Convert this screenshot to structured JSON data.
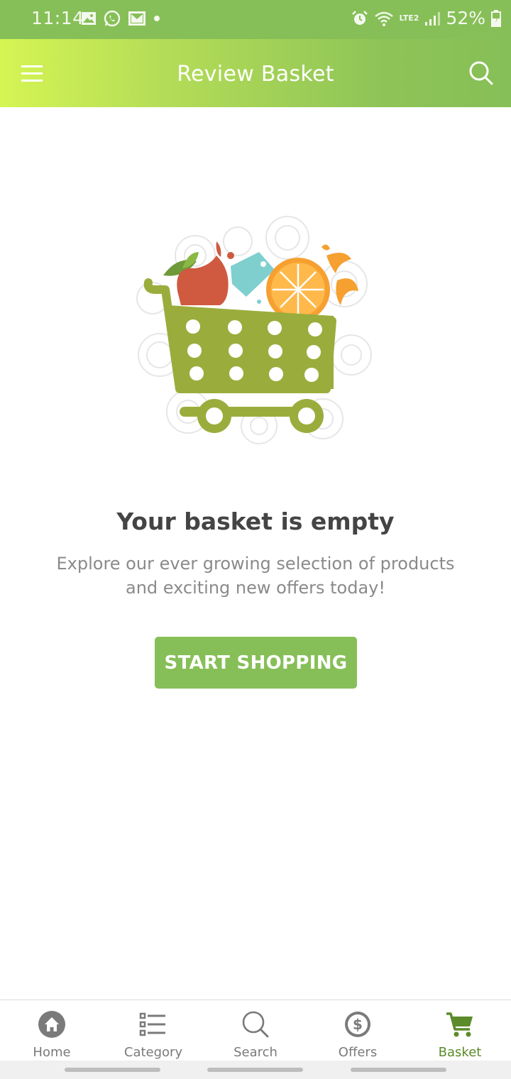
{
  "status_bar": {
    "time": "11:14",
    "battery": "52%",
    "network": "LTE2",
    "left_icons": [
      "image-icon",
      "whatsapp-icon",
      "mail-icon",
      "dot-icon"
    ],
    "right_icons": [
      "alarm-icon",
      "wifi-icon",
      "signal-icon",
      "battery-icon"
    ]
  },
  "app_bar": {
    "title": "Review Basket"
  },
  "empty_state": {
    "title": "Your basket is empty",
    "line1": "Explore our ever growing selection of products",
    "line2": "and exciting new offers today!",
    "button": "START SHOPPING"
  },
  "bottom_nav": {
    "items": [
      {
        "label": "Home",
        "icon": "home-icon"
      },
      {
        "label": "Category",
        "icon": "list-icon"
      },
      {
        "label": "Search",
        "icon": "search-icon"
      },
      {
        "label": "Offers",
        "icon": "dollar-coin-icon"
      },
      {
        "label": "Basket",
        "icon": "cart-icon"
      }
    ],
    "active": "Basket"
  },
  "colors": {
    "primary": "#86bf57",
    "gradient_start": "#d5f553",
    "cart_green": "#9aad3c",
    "active_nav": "#5b8b2a",
    "title_text": "#444444",
    "body_text": "#8a8a8a"
  }
}
